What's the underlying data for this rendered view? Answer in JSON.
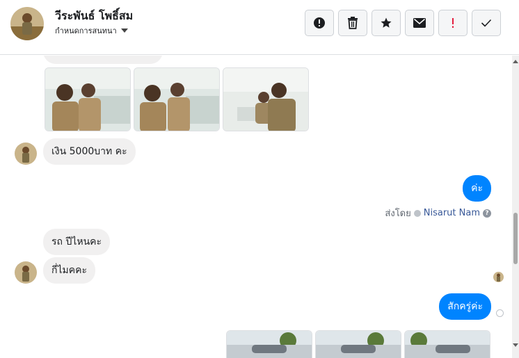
{
  "header": {
    "title": "วีระพันธ์ โพธิ์สม",
    "subtitle": "กำหนดการสนทนา",
    "toolbar": {
      "icons": [
        "alert-circle-icon",
        "trash-icon",
        "star-icon",
        "envelope-icon",
        "exclamation-icon",
        "check-icon"
      ],
      "important_color": "#e41e3f"
    }
  },
  "messages": {
    "m1": "เงิน 5000บาท คะ",
    "m2": "ค่ะ",
    "sent_by_label": "ส่งโดย",
    "sent_by_name": "Nisarut Nam",
    "help_glyph": "?",
    "m3": "รถ ปีไหนคะ",
    "m4": "กี่ไมคคะ",
    "m5": "สักครู่ค่ะ"
  },
  "colors": {
    "accent": "#0084ff",
    "incoming_bubble": "#f1f0f0",
    "link": "#385898"
  }
}
